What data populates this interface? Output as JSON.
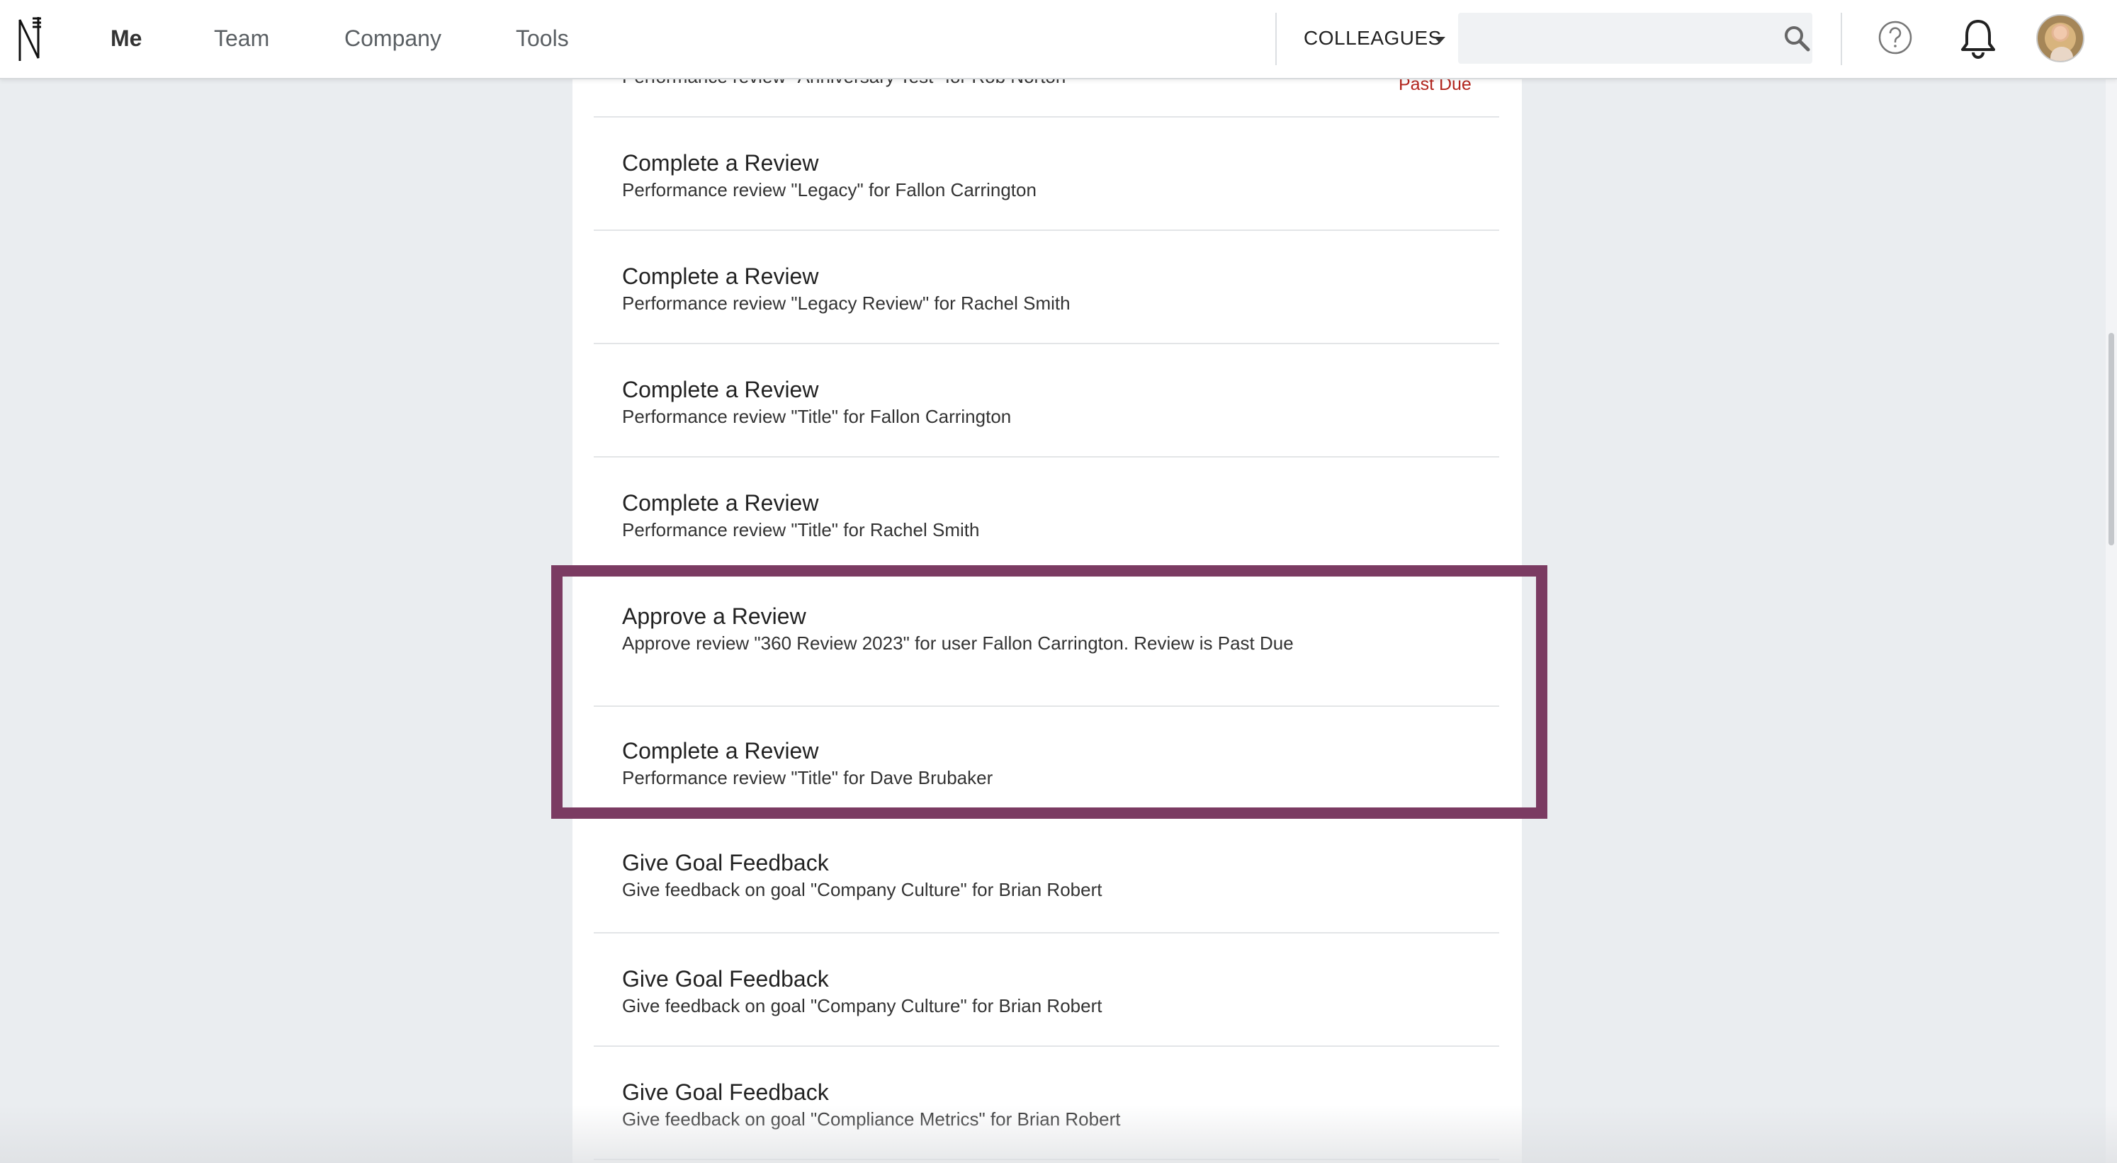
{
  "nav": {
    "items": [
      {
        "label": "Me"
      },
      {
        "label": "Team"
      },
      {
        "label": "Company"
      },
      {
        "label": "Tools"
      }
    ],
    "colleagues_label": "COLLEAGUES",
    "search_placeholder": ""
  },
  "tasks": [
    {
      "title": "",
      "subtitle": "Performance review \"Anniversary Test\" for Rob Norton",
      "status": "Past Due"
    },
    {
      "title": "Complete a Review",
      "subtitle": "Performance review \"Legacy\" for Fallon Carrington"
    },
    {
      "title": "Complete a Review",
      "subtitle": "Performance review \"Legacy Review\" for Rachel Smith"
    },
    {
      "title": "Complete a Review",
      "subtitle": "Performance review \"Title\" for Fallon Carrington"
    },
    {
      "title": "Complete a Review",
      "subtitle": "Performance review \"Title\" for Rachel Smith"
    },
    {
      "title": "Approve a Review",
      "subtitle": "Approve review \"360 Review 2023\" for user Fallon Carrington. Review is Past Due"
    },
    {
      "title": "Complete a Review",
      "subtitle": "Performance review \"Title\" for Dave Brubaker"
    },
    {
      "title": "Give Goal Feedback",
      "subtitle": "Give feedback on goal \"Company Culture\" for Brian Robert"
    },
    {
      "title": "Give Goal Feedback",
      "subtitle": "Give feedback on goal \"Company Culture\" for Brian Robert"
    },
    {
      "title": "Give Goal Feedback",
      "subtitle": "Give feedback on goal \"Compliance Metrics\" for Brian Robert"
    }
  ],
  "colors": {
    "highlight_border": "#7b3b62",
    "past_due": "#b3261e"
  },
  "icons": [
    "app-logo-icon",
    "caret-down-icon",
    "search-icon",
    "help-icon",
    "bell-icon"
  ]
}
